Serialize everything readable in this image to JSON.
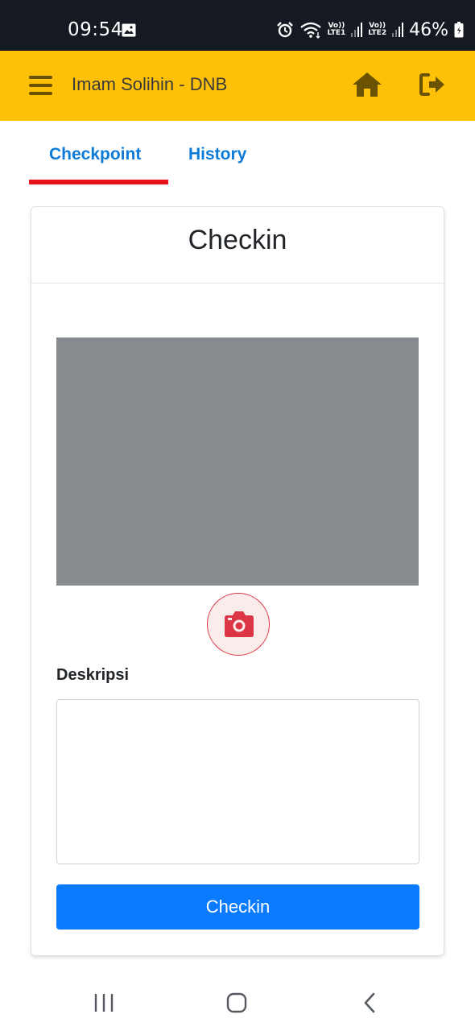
{
  "status_bar": {
    "time": "09:54",
    "sim1_label_top": "Vo))",
    "sim1_label_bottom": "LTE1",
    "sim2_label_top": "Vo))",
    "sim2_label_bottom": "LTE2",
    "battery_percent": "46%",
    "icons": [
      "gallery-icon",
      "alarm-icon",
      "wifi-icon",
      "signal-icon",
      "battery-icon"
    ]
  },
  "app_bar": {
    "title": "Imam Solihin - DNB",
    "background_color": "#ffc107",
    "icons": [
      "hamburger-menu-icon",
      "home-icon",
      "logout-icon"
    ]
  },
  "tabs": {
    "items": [
      {
        "label": "Checkpoint",
        "active": true
      },
      {
        "label": "History",
        "active": false
      }
    ],
    "indicator_color": "#e8141c",
    "label_color": "#0d7bd7"
  },
  "card": {
    "title": "Checkin",
    "camera_button_icon": "camera-icon",
    "description_label": "Deskripsi",
    "description_value": "",
    "description_placeholder": "",
    "submit_label": "Checkin",
    "submit_color": "#0a7bff"
  },
  "nav_bar": {
    "icons": [
      "recent-apps-icon",
      "home-nav-icon",
      "back-icon"
    ]
  }
}
